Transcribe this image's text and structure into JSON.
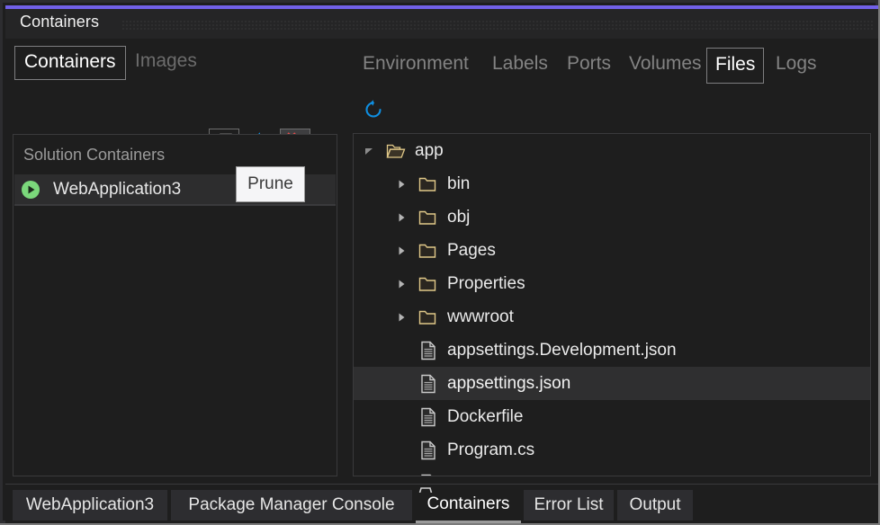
{
  "window": {
    "title": "Containers",
    "accent_color": "#7160e8"
  },
  "left_panel": {
    "tabs": [
      {
        "label": "Containers",
        "active": true
      },
      {
        "label": "Images",
        "active": false
      }
    ],
    "toolbar": [
      {
        "name": "start-button",
        "icon": "play-icon",
        "state": "normal"
      },
      {
        "name": "stop-button",
        "icon": "stop-square-icon",
        "state": "normal"
      },
      {
        "name": "open-terminal-button",
        "icon": "terminal-icon",
        "state": "normal"
      },
      {
        "name": "settings-button",
        "icon": "gears-icon",
        "state": "normal"
      },
      {
        "name": "remove-button",
        "icon": "close-x-icon",
        "state": "normal"
      },
      {
        "name": "show-all-containers-button",
        "icon": "stacked-windows-icon",
        "state": "bordered"
      },
      {
        "name": "refresh-button",
        "icon": "refresh-icon",
        "state": "normal"
      },
      {
        "name": "prune-button",
        "icon": "prune-stacked-windows-icon",
        "state": "hovered"
      }
    ],
    "tooltip": {
      "text": "Prune",
      "for": "prune-button"
    },
    "list": {
      "header": "Solution Containers",
      "rows": [
        {
          "label": "WebApplication3",
          "status_icon": "running-play-icon",
          "selected": true
        }
      ]
    }
  },
  "right_panel": {
    "tabs": [
      {
        "label": "Environment",
        "active": false
      },
      {
        "label": "Labels",
        "active": false
      },
      {
        "label": "Ports",
        "active": false
      },
      {
        "label": "Volumes",
        "active": false
      },
      {
        "label": "Files",
        "active": true
      },
      {
        "label": "Logs",
        "active": false
      }
    ],
    "toolbar": [
      {
        "name": "refresh-files-button",
        "icon": "refresh-icon"
      }
    ],
    "tree": [
      {
        "label": "app",
        "type": "folder",
        "depth": 0,
        "expanded": true,
        "selected": false
      },
      {
        "label": "bin",
        "type": "folder",
        "depth": 1,
        "expanded": false,
        "selected": false
      },
      {
        "label": "obj",
        "type": "folder",
        "depth": 1,
        "expanded": false,
        "selected": false
      },
      {
        "label": "Pages",
        "type": "folder",
        "depth": 1,
        "expanded": false,
        "selected": false
      },
      {
        "label": "Properties",
        "type": "folder",
        "depth": 1,
        "expanded": false,
        "selected": false
      },
      {
        "label": "wwwroot",
        "type": "folder",
        "depth": 1,
        "expanded": false,
        "selected": false
      },
      {
        "label": "appsettings.Development.json",
        "type": "file",
        "depth": 1,
        "expanded": false,
        "selected": false
      },
      {
        "label": "appsettings.json",
        "type": "file",
        "depth": 1,
        "expanded": false,
        "selected": true
      },
      {
        "label": "Dockerfile",
        "type": "file",
        "depth": 1,
        "expanded": false,
        "selected": false
      },
      {
        "label": "Program.cs",
        "type": "file",
        "depth": 1,
        "expanded": false,
        "selected": false
      },
      {
        "label": "",
        "type": "file",
        "depth": 1,
        "expanded": false,
        "selected": false
      }
    ]
  },
  "bottom_tabs": [
    {
      "label": "WebApplication3",
      "active": false
    },
    {
      "label": "Package Manager Console",
      "active": false
    },
    {
      "label": "Containers",
      "active": true
    },
    {
      "label": "Error List",
      "active": false
    },
    {
      "label": "Output",
      "active": false
    }
  ],
  "colors": {
    "background": "#1e1e1e",
    "panel_chrome": "#2d2d30",
    "folder": "#e0c888",
    "file": "#c8c8c8",
    "blue_action": "#0a84d8",
    "red_action": "#e05252",
    "green_running": "#7bd87b"
  }
}
